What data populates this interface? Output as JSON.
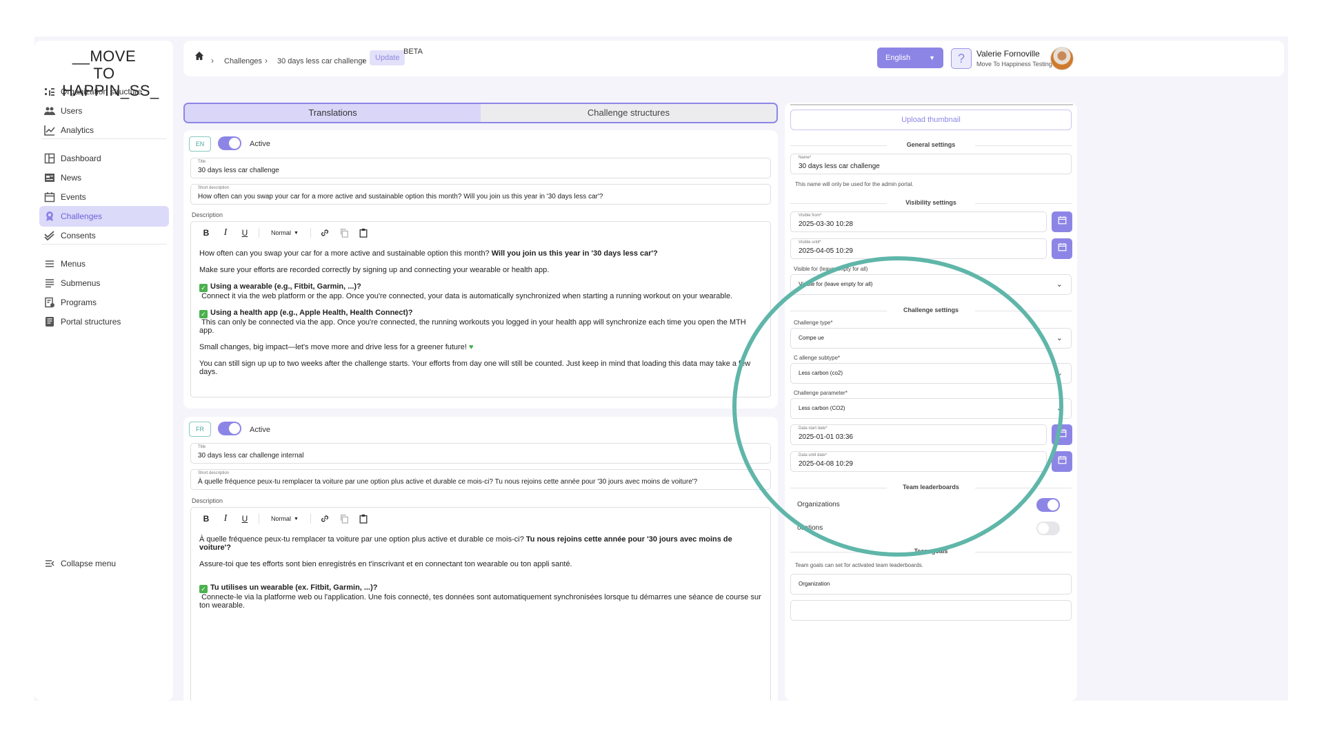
{
  "sidebar": {
    "logo_line1": "__MOVE TO",
    "logo_line2": "HAPPIN_SS_",
    "items": [
      {
        "label": "Organization structure",
        "icon": "org-structure-icon"
      },
      {
        "label": "Users",
        "icon": "users-icon"
      },
      {
        "label": "Analytics",
        "icon": "analytics-icon"
      },
      {
        "label": "Dashboard",
        "icon": "dashboard-icon"
      },
      {
        "label": "News",
        "icon": "news-icon"
      },
      {
        "label": "Events",
        "icon": "calendar-icon"
      },
      {
        "label": "Challenges",
        "icon": "award-icon",
        "active": true
      },
      {
        "label": "Consents",
        "icon": "double-check-icon"
      },
      {
        "label": "Menus",
        "icon": "menu-icon"
      },
      {
        "label": "Submenus",
        "icon": "submenu-icon"
      },
      {
        "label": "Programs",
        "icon": "programs-icon"
      },
      {
        "label": "Portal structures",
        "icon": "portal-icon"
      }
    ],
    "collapse_label": "Collapse menu"
  },
  "topbar": {
    "breadcrumb": [
      "Challenges",
      "30 days less car challenge"
    ],
    "current": "Update",
    "beta": "BETA",
    "language": "English",
    "help": "?",
    "user_name": "Valerie Fornoville",
    "user_org": "Move To Happiness Testing"
  },
  "tabs": {
    "translations": "Translations",
    "structures": "Challenge structures"
  },
  "en": {
    "code": "EN",
    "active_label": "Active",
    "title_caption": "Title",
    "title": "30 days less car challenge",
    "short_caption": "Short description",
    "short": "How often can you swap your car for a more active and sustainable option this month? Will you join us this year in '30 days less car'?",
    "description_label": "Description",
    "format": "Normal",
    "p1_a": "How often can you swap your car for a more active and sustainable option this month? ",
    "p1_b": "Will you join us this year in '30 days less car'?",
    "p2": "Make sure your efforts are recorded correctly by signing up and connecting your wearable or health app.",
    "p3_title": "Using a wearable (e.g., Fitbit, Garmin, ...)?",
    "p3_body": "Connect it via the web platform or the app. Once you're connected, your data is automatically synchronized when starting a running workout on your wearable.",
    "p4_title": "Using a health app (e.g., Apple Health, Health Connect)?",
    "p4_body": "This can only be connected via the app. Once you're connected, the running workouts you logged in your health app will synchronize each time you open the MTH app.",
    "p5": "Small changes, big impact—let's move more and drive less for a greener future!",
    "p6": "You can still sign up up to two weeks after the challenge starts. Your efforts from day one will still be counted. Just keep in mind that loading this data may take a few days."
  },
  "fr": {
    "code": "FR",
    "active_label": "Active",
    "title_caption": "Title",
    "title": "30 days less car challenge internal",
    "short_caption": "Short description",
    "short": "À quelle fréquence peux-tu remplacer ta voiture par une option plus active et durable ce mois-ci? Tu nous rejoins cette année pour '30 jours avec moins de voiture'?",
    "description_label": "Description",
    "format": "Normal",
    "p1_a": "À quelle fréquence peux-tu remplacer ta voiture par une option plus active et durable ce mois-ci? ",
    "p1_b": "Tu nous rejoins cette année pour '30 jours avec moins de voiture'?",
    "p2": "Assure-toi que tes efforts sont bien enregistrés en t'inscrivant et en connectant ton wearable ou ton appli santé.",
    "p3_title": "Tu utilises un wearable (ex. Fitbit, Garmin, ...)?",
    "p3_body": "Connecte-le via la platforme web ou l'application. Une fois connecté, tes données sont automatiquement synchronisées lorsque tu démarres une séance de course sur ton wearable."
  },
  "settings": {
    "upload_thumbnail": "Upload thumbnail",
    "general_title": "General settings",
    "name_caption": "Name*",
    "name": "30 days less car challenge",
    "name_note": "This name will only be used for the admin portal.",
    "visibility_title": "Visibility settings",
    "visible_from_caption": "Visible from*",
    "visible_from": "2025-03-30 10:28",
    "visible_until_caption": "Visible until*",
    "visible_until": "2025-04-05 10:29",
    "visible_for_label": "Visible for (leave empty for all)",
    "visible_for_value": "Visible for (leave empty for all)",
    "challenge_title": "Challenge settings",
    "type_label": "Challenge type*",
    "type_value": "Compe  ue",
    "subtype_label": "C  allenge subtype*",
    "subtype_value": "Less carbon (co2)",
    "parameter_label": "Challenge parameter*",
    "parameter_value": "Less carbon (CO2)",
    "start_caption": "Data start date*",
    "start_value": "2025-01-01 03:36",
    "until_caption": "Data until date*",
    "until_value": "2025-04-08 10:29",
    "leaderboards_title": "Team leaderboards",
    "org_label": "Organizations",
    "loc_label": "ocations",
    "goals_title": "Team goals",
    "goals_note": "Team goals can    set for activated team leaderboards.",
    "goals_org": "Organization"
  },
  "colors": {
    "accent": "#8d85e6",
    "highlight": "#5fb6a9"
  }
}
